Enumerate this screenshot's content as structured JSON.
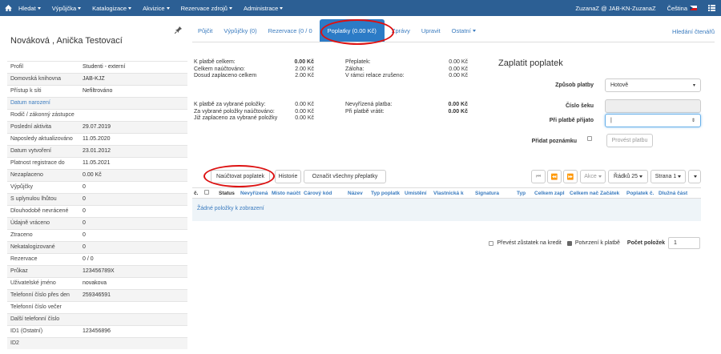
{
  "navbar": {
    "items": [
      "Hledat",
      "Výpůjčka",
      "Katalogizace",
      "Akvizice",
      "Rezervace zdrojů",
      "Administrace"
    ],
    "user": "ZuzanaZ @ JAB-KN-ZuzanaZ",
    "language": "Čeština"
  },
  "patron": {
    "name": "Nováková , Anička Testovací",
    "fields": [
      {
        "k": "Profil",
        "v": "Studenti - externí"
      },
      {
        "k": "Domovská knihovna",
        "v": "JAB-KJZ"
      },
      {
        "k": "Přístup k síti",
        "v": "Nefiltrováno"
      },
      {
        "k": "Datum narození",
        "v": ""
      },
      {
        "k": "Rodič / zákonný zástupce",
        "v": ""
      },
      {
        "k": "Poslední aktivita",
        "v": "29.07.2019"
      },
      {
        "k": "Naposledy aktualizováno",
        "v": "11.05.2020"
      },
      {
        "k": "Datum vytvoření",
        "v": "23.01.2012"
      },
      {
        "k": "Platnost registrace do",
        "v": "11.05.2021"
      },
      {
        "k": "Nezaplaceno",
        "v": "0.00 Kč"
      },
      {
        "k": "Výpůjčky",
        "v": "0"
      },
      {
        "k": "S uplynulou lhůtou",
        "v": "0"
      },
      {
        "k": "Dlouhodobě nevrácené",
        "v": "0"
      },
      {
        "k": "Údajně vráceno",
        "v": "0"
      },
      {
        "k": "Ztraceno",
        "v": "0"
      },
      {
        "k": "Nekatalogizované",
        "v": "0"
      },
      {
        "k": "Rezervace",
        "v": "0 / 0"
      },
      {
        "k": "Průkaz",
        "v": "123456789X"
      },
      {
        "k": "Uživatelské jméno",
        "v": "novakova"
      },
      {
        "k": "Telefonní číslo přes den",
        "v": "259346591"
      },
      {
        "k": "Telefonní číslo večer",
        "v": ""
      },
      {
        "k": "Další telefonní číslo",
        "v": ""
      },
      {
        "k": "ID1 (Ostatní)",
        "v": "123456896"
      },
      {
        "k": "ID2",
        "v": ""
      }
    ]
  },
  "tabs": [
    "Půjčit",
    "Výpůjčky (0)",
    "Rezervace (0 / 0",
    "Poplatky (0.00 Kč)",
    "Zprávy",
    "Upravit",
    "Ostatní"
  ],
  "search_patrons": "Hledání čtenářů",
  "summary": {
    "col1": [
      {
        "l": "K platbě celkem:",
        "v": "0.00 Kč",
        "bold": true
      },
      {
        "l": "Celkem naúčtováno:",
        "v": "2.00 Kč",
        "bold": false
      },
      {
        "l": "Dosud zaplaceno celkem",
        "v": "2.00 Kč",
        "bold": false
      }
    ],
    "col2": [
      {
        "l": "Přeplatek:",
        "v": "0.00 Kč"
      },
      {
        "l": "Záloha:",
        "v": "0.00 Kč"
      },
      {
        "l": "V rámci relace zrušeno:",
        "v": "0.00 Kč"
      }
    ],
    "col3": [
      {
        "l": "K platbě za vybrané položky:",
        "v": "0.00 Kč"
      },
      {
        "l": "Za vybrané položky naúčtováno:",
        "v": "0.00 Kč"
      },
      {
        "l": "Již zaplaceno za vybrané položky",
        "v": "0.00 Kč"
      }
    ],
    "col4": [
      {
        "l": "Nevyřízená platba:",
        "v": "0.00 Kč",
        "bold": true
      },
      {
        "l": "Při platbě vrátit:",
        "v": "0.00 Kč",
        "bold": true
      }
    ]
  },
  "pay": {
    "title": "Zaplatit poplatek",
    "method_label": "Způsob platby",
    "method_value": "Hotově",
    "check_label": "Číslo šeku",
    "received_label": "Při platbě přijato",
    "received_value": "|",
    "note_label": "Přidat poznámku",
    "submit": "Provést platbu"
  },
  "actions": {
    "bill": "Naúčtovat poplatek",
    "history": "Historie",
    "mark_all": "Označit všechny přeplatky"
  },
  "pager": {
    "first": "⏮",
    "prev": "⏪",
    "next": "⏩",
    "action": "Akce",
    "rows": "Řádků 25",
    "page": "Strana 1"
  },
  "grid": {
    "columns": [
      "č.",
      "",
      "Status",
      "Nevyřízená",
      "Místo naúčt",
      "Čárový kód",
      "Název",
      "Typ poplatk",
      "Umístění",
      "Vlastnická k",
      "Signatura",
      "Typ",
      "Celkem zapl",
      "Celkem nač",
      "Začátek",
      "Poplatek č.",
      "Dlužná část"
    ],
    "empty": "Žádné položky k zobrazení"
  },
  "bottom": {
    "transfer": "Převést zůstatek na kredit",
    "confirm": "Potvrzení k platbě",
    "count_label": "Počet položek",
    "count_value": "1"
  },
  "colors": {
    "navbar": "#2c5f94",
    "active_tab": "#2c7bc6",
    "link": "#3a7bbf",
    "annotation": "#dd1111"
  }
}
